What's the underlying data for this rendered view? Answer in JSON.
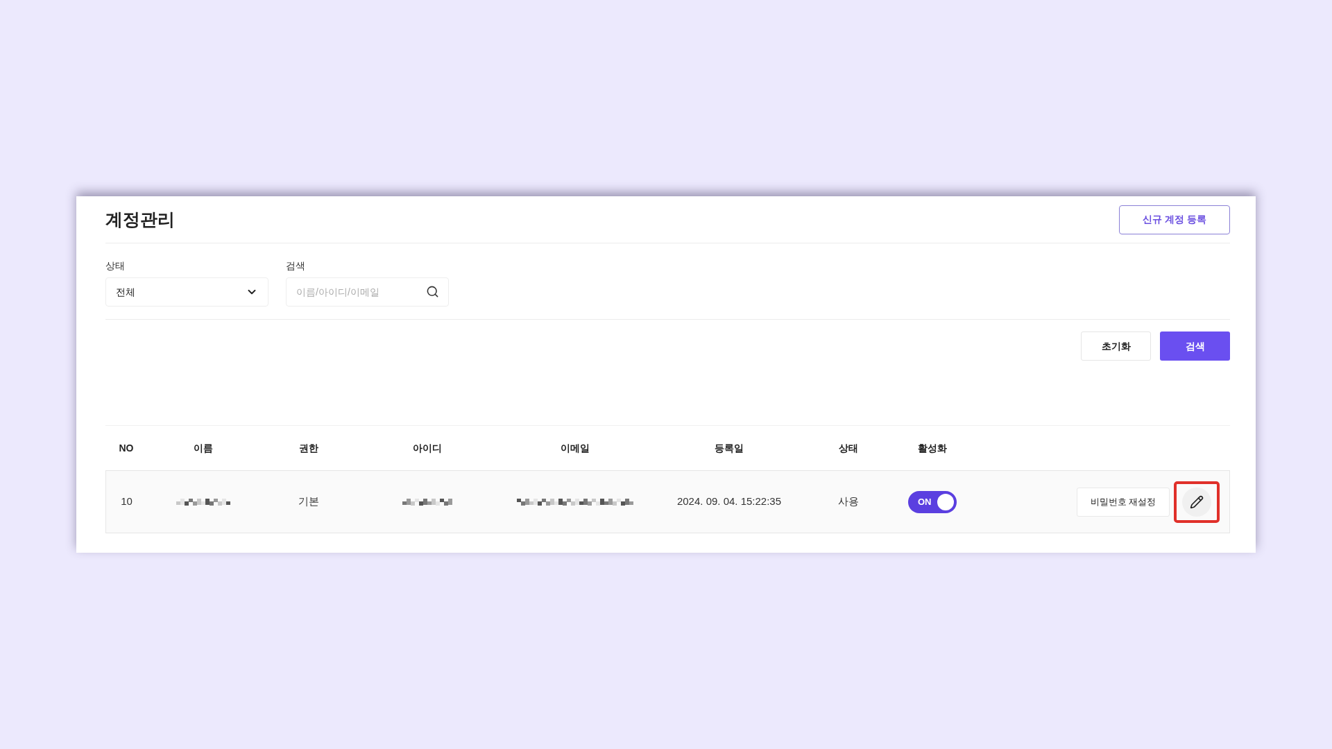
{
  "page": {
    "title": "계정관리",
    "new_button": "신규 계정 등록"
  },
  "filters": [
    {
      "kind": "select",
      "label": "상태",
      "value": "전체"
    },
    {
      "kind": "search",
      "label": "검색",
      "placeholder": "이름/아이디/이메일"
    }
  ],
  "actions": [
    {
      "label": "초기화",
      "primary": false
    },
    {
      "label": "검색",
      "primary": true
    }
  ],
  "table": {
    "columns": [
      "NO",
      "이름",
      "권한",
      "아이디",
      "이메일",
      "등록일",
      "상태",
      "활성화"
    ],
    "rows": [
      {
        "cells": [
          {
            "kind": "text",
            "text": "10"
          },
          {
            "kind": "pixelated"
          },
          {
            "kind": "text",
            "text": "기본"
          },
          {
            "kind": "pixelated"
          },
          {
            "kind": "pixelated"
          },
          {
            "kind": "text",
            "text": "2024. 09. 04. 15:22:35"
          },
          {
            "kind": "text",
            "text": "사용"
          },
          {
            "kind": "toggle",
            "on": true,
            "text": "ON"
          }
        ],
        "reset_button": "비밀번호 재설정",
        "edit_highlighted": true
      }
    ]
  }
}
